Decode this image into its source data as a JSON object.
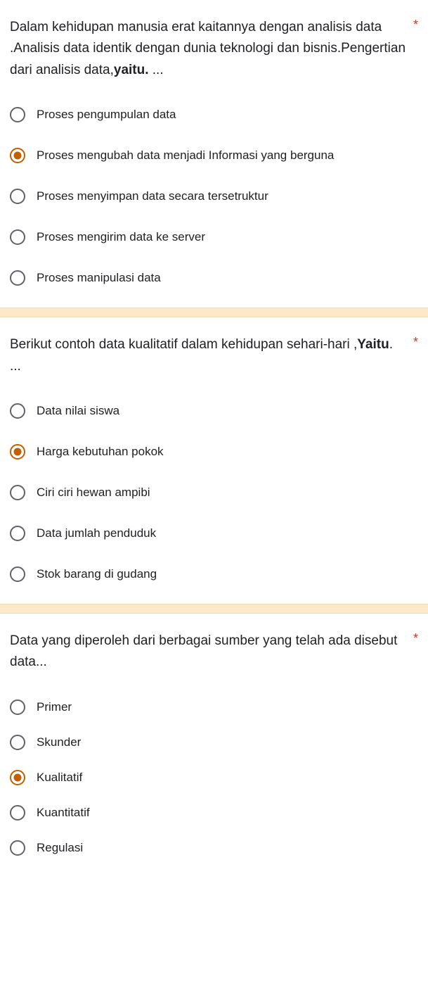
{
  "questions": [
    {
      "title_pre": "Dalam kehidupan manusia erat kaitannya dengan analisis data .Analisis data identik dengan dunia teknologi dan bisnis.Pengertian dari analisis data,",
      "title_bold": "yaitu.",
      "title_post": " ...",
      "required_mark": "*",
      "options": [
        "Proses pengumpulan data",
        "Proses mengubah data menjadi Informasi yang berguna",
        "Proses menyimpan data secara tersetruktur",
        "Proses mengirim data ke server",
        "Proses manipulasi data"
      ],
      "selected": 1
    },
    {
      "title_pre": "Berikut contoh data kualitatif dalam kehidupan sehari-hari ,",
      "title_bold": "Yaitu",
      "title_post": ". ...",
      "required_mark": "*",
      "options": [
        "Data nilai siswa",
        "Harga kebutuhan pokok",
        "Ciri ciri hewan ampibi",
        "Data jumlah penduduk",
        "Stok barang di gudang"
      ],
      "selected": 1
    },
    {
      "title_pre": "Data yang diperoleh dari berbagai sumber yang telah ada disebut data...",
      "title_bold": "",
      "title_post": "",
      "required_mark": "*",
      "options": [
        "Primer",
        "Skunder",
        "Kualitatif",
        "Kuantitatif",
        "Regulasi"
      ],
      "selected": 2
    }
  ]
}
